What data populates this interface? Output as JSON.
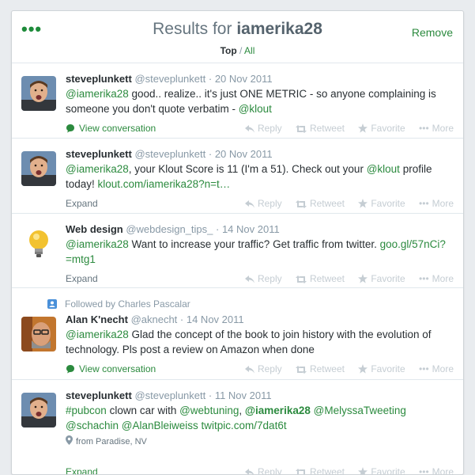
{
  "header": {
    "title_prefix": "Results for",
    "query": "iamerika28",
    "remove_label": "Remove",
    "filter_top": "Top",
    "filter_sep": " / ",
    "filter_all": "All"
  },
  "actions": {
    "reply": "Reply",
    "retweet": "Retweet",
    "favorite": "Favorite",
    "more": "More"
  },
  "tweets": [
    {
      "name": "steveplunkett",
      "handle": "@steveplunkett",
      "time": "· 20 Nov 2011",
      "mention": "@iamerika28",
      "text_a": " good.. realize.. it's just ONE METRIC - so anyone complaining is someone you don't quote verbatim - ",
      "tail_link": "@klout",
      "footer": "View conversation"
    },
    {
      "name": "steveplunkett",
      "handle": "@steveplunkett",
      "time": "· 20 Nov 2011",
      "mention": "@iamerika28",
      "text_a": ", your Klout Score is 11 (I'm a 51). Check out your ",
      "mid_link": "@klout",
      "text_b": " profile today! ",
      "tail_link": "klout.com/iamerika28?n=t…",
      "footer": "Expand"
    },
    {
      "name": "Web design",
      "handle": "@webdesign_tips_",
      "time": "· 14 Nov 2011",
      "mention": "@iamerika28",
      "text_a": " Want to increase your traffic? Get traffic from twitter. ",
      "tail_link": "goo.gl/57nCi?=mtg1",
      "footer": "Expand"
    },
    {
      "context": "Followed by Charles Pascalar",
      "name": "Alan K'necht",
      "handle": "@aknecht",
      "time": "· 14 Nov 2011",
      "mention": "@iamerika28",
      "text_a": " Glad the concept of the book to join history with the evolution of technology. Pls post a review on Amazon when done",
      "footer": "View conversation"
    },
    {
      "name": "steveplunkett",
      "handle": "@steveplunkett",
      "time": "· 11 Nov 2011",
      "hashtag": "#pubcon",
      "text_a": " clown car with ",
      "m1": "@webtuning",
      "sep1": ", ",
      "m2": "@iamerika28",
      "sep2": "  ",
      "m3": "@MelyssaTweeting",
      "sep3": " ",
      "m4": "@schachin",
      "sep4": " ",
      "m5": "@AlanBleiweiss",
      "sep5": " ",
      "tail_link": "twitpic.com/7dat6t",
      "geo": "from Paradise, NV",
      "footer": "Expand"
    }
  ],
  "colors": {
    "accent_green": "#2b8a3e",
    "muted": "#8899a6",
    "action_grey": "#c5cdd3"
  }
}
